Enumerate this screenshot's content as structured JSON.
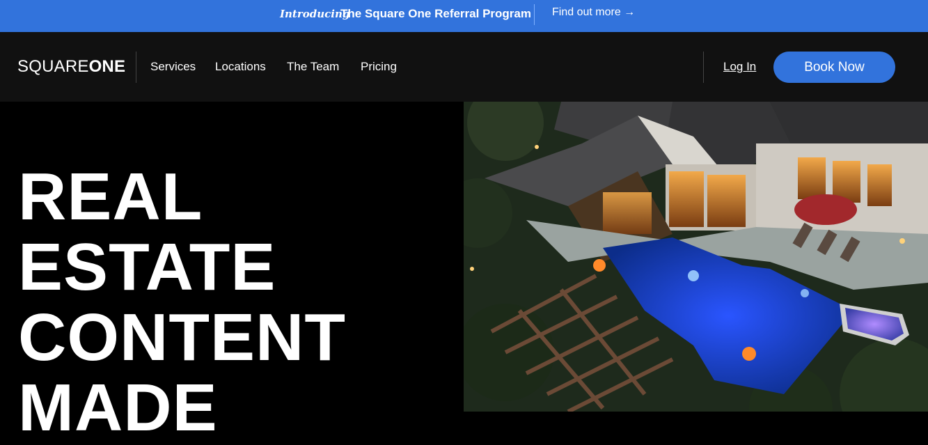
{
  "announcement": {
    "intro": "Introducing",
    "program": "The Square One Referral Program",
    "link": "Find out more →"
  },
  "nav": {
    "logo_light": "SQUARE",
    "logo_bold": "ONE",
    "items": [
      "Services",
      "Locations",
      "The Team",
      "Pricing"
    ],
    "login": "Log In",
    "book": "Book Now"
  },
  "hero": {
    "headline": [
      "REAL",
      "ESTATE",
      "CONTENT",
      "MADE"
    ]
  },
  "colors": {
    "accent": "#3273dc",
    "nav_bg": "#111111",
    "hero_bg": "#000000"
  }
}
